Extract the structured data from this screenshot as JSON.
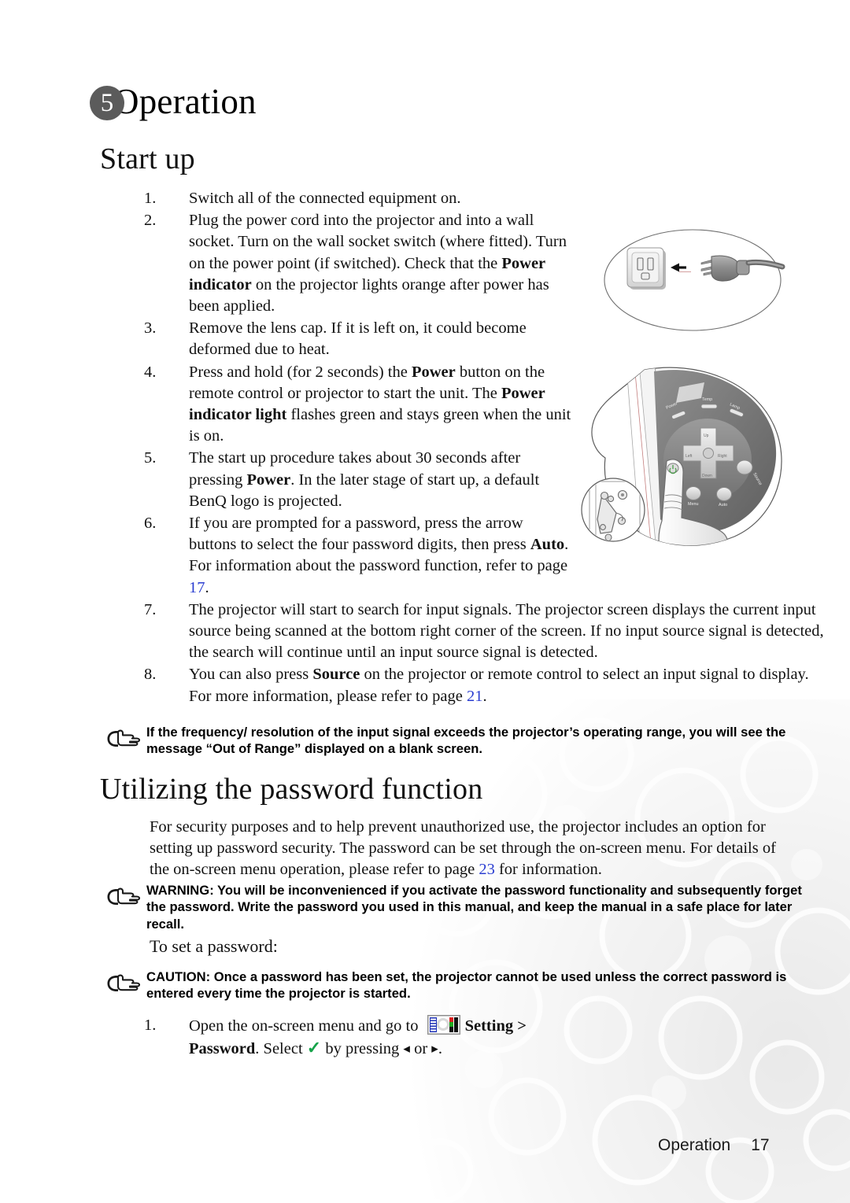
{
  "chapter": {
    "number": "5",
    "title": "Operation"
  },
  "sections": {
    "startup_heading": "Start up",
    "password_heading": "Utilizing the password function"
  },
  "startup_steps": [
    {
      "num": "1.",
      "parts": [
        {
          "t": "Switch all of the connected equipment on."
        }
      ]
    },
    {
      "num": "2.",
      "parts": [
        {
          "t": "Plug the power cord into the projector and into a wall socket. Turn on the wall socket switch (where fitted). Turn on the power point (if switched). Check that the "
        },
        {
          "t": "Power indicator",
          "style": "bold"
        },
        {
          "t": " on the projector lights orange after power has been applied."
        }
      ]
    },
    {
      "num": "3.",
      "parts": [
        {
          "t": "Remove the lens cap. If it is left on, it could become deformed due to heat."
        }
      ]
    },
    {
      "num": "4.",
      "parts": [
        {
          "t": "Press and hold (for 2 seconds) the "
        },
        {
          "t": "Power",
          "style": "bold"
        },
        {
          "t": " button on the remote control or projector to start the unit. The "
        },
        {
          "t": "Power indicator light",
          "style": "bold"
        },
        {
          "t": " flashes green and stays green when the unit is on."
        }
      ]
    },
    {
      "num": "5.",
      "parts": [
        {
          "t": "The start up procedure takes about 30 seconds after pressing "
        },
        {
          "t": "Power",
          "style": "bold"
        },
        {
          "t": ". In the later stage of start up, a default BenQ logo is projected."
        }
      ]
    },
    {
      "num": "6.",
      "parts": [
        {
          "t": "If you are prompted for a password, press the arrow buttons to select the four password digits, then press "
        },
        {
          "t": "Auto",
          "style": "bold"
        },
        {
          "t": ". For information about the password function, refer to page "
        },
        {
          "t": "17",
          "style": "link"
        },
        {
          "t": "."
        }
      ]
    },
    {
      "num": "7.",
      "wide": true,
      "parts": [
        {
          "t": "The projector will start to search for input signals. The projector screen displays the current input source being scanned at the bottom right corner of the screen. If no input source signal is detected, the search will continue until an input source signal is detected."
        }
      ]
    },
    {
      "num": "8.",
      "wide": true,
      "parts": [
        {
          "t": "You can also press "
        },
        {
          "t": "Source",
          "style": "bold"
        },
        {
          "t": " on the projector or remote control to select an input signal to display. For more information, please refer to page "
        },
        {
          "t": "21",
          "style": "link"
        },
        {
          "t": "."
        }
      ]
    }
  ],
  "notes": {
    "out_of_range": "If the frequency/ resolution of the input signal exceeds the projector’s operating range, you will see the message “Out of Range” displayed on a blank screen.",
    "warning": "WARNING: You will be inconvenienced if you activate the password functionality and subsequently forget the password. Write the password you used in this manual, and keep the manual in a safe place for later recall.",
    "caution": "CAUTION: Once a password has been set, the projector cannot be used unless the correct password is entered every time the projector is started."
  },
  "password_paragraph": {
    "parts": [
      {
        "t": "For security purposes and to help prevent unauthorized use, the projector includes an option for setting up password security. The password can be set through the on-screen menu. For details of the on-screen menu operation, please refer to page "
      },
      {
        "t": "23",
        "style": "link"
      },
      {
        "t": " for information."
      }
    ]
  },
  "subhead_set_password": "To set a password:",
  "set_password_steps": [
    {
      "num": "1.",
      "parts": [
        {
          "t": "Open the on-screen menu and go to "
        },
        {
          "t": "",
          "style": "menu-icon",
          "icon": "osd-setting-menu-icon"
        },
        {
          "t": "Setting > Password",
          "style": "bold"
        },
        {
          "t": ". Select "
        },
        {
          "t": "✓",
          "style": "check"
        },
        {
          "t": " by pressing "
        },
        {
          "t": "◂",
          "style": "arrow"
        },
        {
          "t": " or "
        },
        {
          "t": "▸",
          "style": "arrow"
        },
        {
          "t": "."
        }
      ]
    }
  ],
  "figures": {
    "socket": {
      "name": "power-cord-into-wall-socket-illustration",
      "elements": [
        "wall-socket",
        "left-arrow",
        "power-plug",
        "cable"
      ]
    },
    "panel": {
      "name": "projector-control-panel-illustration",
      "button_labels": [
        "Power",
        "Temp",
        "Lamp",
        "Up",
        "Down",
        "Left",
        "Right",
        "Menu",
        "Auto",
        "Source"
      ]
    }
  },
  "footer": {
    "section": "Operation",
    "page_number": "17"
  },
  "colors": {
    "badge_gray": "#5b5b5b",
    "link_blue": "#2b3ed1",
    "check_green": "#16a34a",
    "text_black": "#111111"
  }
}
